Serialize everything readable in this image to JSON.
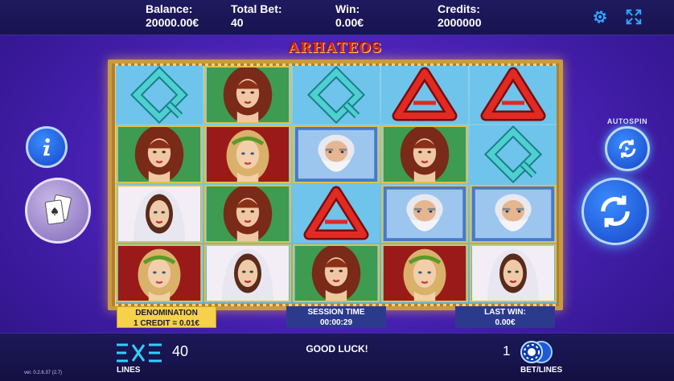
{
  "topbar": {
    "balance_label": "Balance:",
    "balance_value": "20000.00€",
    "total_bet_label": "Total Bet:",
    "total_bet_value": "40",
    "win_label": "Win:",
    "win_value": "0.00€",
    "credits_label": "Credits:",
    "credits_value": "2000000",
    "settings_icon": "gear-icon",
    "fullscreen_icon": "fullscreen-expand-icon"
  },
  "game": {
    "title": "ARHATEOS",
    "reels": [
      [
        "Q",
        "woman-redhair",
        "Q",
        "A",
        "A"
      ],
      [
        "woman-redhair",
        "woman-laurel",
        "zeus",
        "woman-redhair",
        "Q"
      ],
      [
        "woman-veil",
        "woman-redhair",
        "A",
        "zeus",
        "zeus"
      ],
      [
        "woman-laurel",
        "woman-veil",
        "woman-redhair",
        "woman-laurel",
        "woman-veil"
      ]
    ]
  },
  "buttons": {
    "info_icon": "info-icon",
    "cards_icon": "gamble-cards-icon",
    "autospin_label": "AUTOSPIN",
    "autospin_icon": "autospin-icon",
    "spin_icon": "spin-icon"
  },
  "panels": {
    "denomination_label": "DENOMINATION",
    "denomination_value": "1 CREDIT = 0.01€",
    "session_label": "SESSION TIME",
    "session_value": "00:00:29",
    "lastwin_label": "LAST WIN:",
    "lastwin_value": "0.00€"
  },
  "bottombar": {
    "lines_value": "40",
    "lines_label": "LINES",
    "message": "GOOD LUCK!",
    "bet_value": "1",
    "bet_label": "BET/LINES",
    "version": "ver. 0.2.6.37 (2.7)"
  },
  "colors": {
    "accent_blue": "#2fa8ff",
    "denomination_bg": "#f5d24a",
    "panel_bg": "#2c3a8e"
  }
}
